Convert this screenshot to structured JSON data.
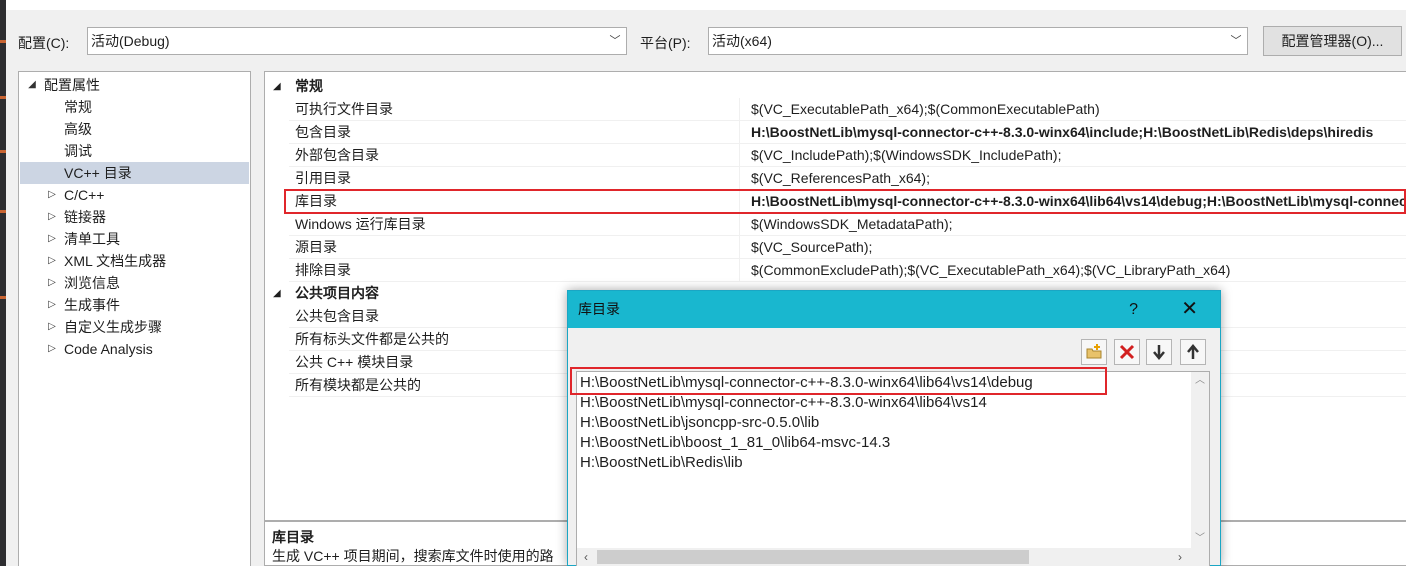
{
  "header": {
    "config_label": "配置(C):",
    "config_value": "活动(Debug)",
    "platform_label": "平台(P):",
    "platform_value": "活动(x64)",
    "config_manager_button": "配置管理器(O)..."
  },
  "tree": {
    "items": [
      {
        "label": "配置属性",
        "glyph": "◢"
      },
      {
        "label": "常规"
      },
      {
        "label": "高级"
      },
      {
        "label": "调试"
      },
      {
        "label": "VC++ 目录"
      },
      {
        "label": "C/C++",
        "glyph": "▷"
      },
      {
        "label": "链接器",
        "glyph": "▷"
      },
      {
        "label": "清单工具",
        "glyph": "▷"
      },
      {
        "label": "XML 文档生成器",
        "glyph": "▷"
      },
      {
        "label": "浏览信息",
        "glyph": "▷"
      },
      {
        "label": "生成事件",
        "glyph": "▷"
      },
      {
        "label": "自定义生成步骤",
        "glyph": "▷"
      },
      {
        "label": "Code Analysis",
        "glyph": "▷"
      }
    ]
  },
  "grid": {
    "categories": [
      {
        "label": "常规",
        "glyph": "◢"
      },
      {
        "label": "公共项目内容",
        "glyph": "◢"
      }
    ],
    "rows": [
      {
        "name": "可执行文件目录",
        "value": "$(VC_ExecutablePath_x64);$(CommonExecutablePath)"
      },
      {
        "name": "包含目录",
        "value": "H:\\BoostNetLib\\mysql-connector-c++-8.3.0-winx64\\include;H:\\BoostNetLib\\Redis\\deps\\hiredis"
      },
      {
        "name": "外部包含目录",
        "value": "$(VC_IncludePath);$(WindowsSDK_IncludePath);"
      },
      {
        "name": "引用目录",
        "value": "$(VC_ReferencesPath_x64);"
      },
      {
        "name": "库目录",
        "value": "H:\\BoostNetLib\\mysql-connector-c++-8.3.0-winx64\\lib64\\vs14\\debug;H:\\BoostNetLib\\mysql-connector"
      },
      {
        "name": "Windows 运行库目录",
        "value": "$(WindowsSDK_MetadataPath);"
      },
      {
        "name": "源目录",
        "value": "$(VC_SourcePath);"
      },
      {
        "name": "排除目录",
        "value": "$(CommonExcludePath);$(VC_ExecutablePath_x64);$(VC_LibraryPath_x64)"
      }
    ],
    "common_rows": [
      {
        "name": "公共包含目录"
      },
      {
        "name": "所有标头文件都是公共的"
      },
      {
        "name": "公共 C++ 模块目录"
      },
      {
        "name": "所有模块都是公共的"
      }
    ]
  },
  "description": {
    "title": "库目录",
    "text": "生成 VC++ 项目期间，搜索库文件时使用的路"
  },
  "dialog": {
    "title": "库目录",
    "help": "?",
    "close": "✕",
    "paths": [
      "H:\\BoostNetLib\\mysql-connector-c++-8.3.0-winx64\\lib64\\vs14\\debug",
      "H:\\BoostNetLib\\mysql-connector-c++-8.3.0-winx64\\lib64\\vs14",
      "H:\\BoostNetLib\\jsoncpp-src-0.5.0\\lib",
      "H:\\BoostNetLib\\boost_1_81_0\\lib64-msvc-14.3",
      "H:\\BoostNetLib\\Redis\\lib"
    ]
  },
  "colors": {
    "accent": "#19b7cf",
    "highlight": "#e0262b",
    "selection": "#ccd5e3"
  },
  "icons": [
    "new-line-icon",
    "delete-icon",
    "move-down-icon",
    "move-up-icon",
    "chevron-down-icon",
    "close-icon",
    "help-icon"
  ]
}
